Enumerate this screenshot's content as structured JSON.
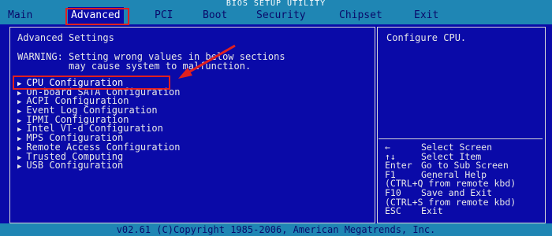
{
  "title": "BIOS SETUP UTILITY",
  "menu": [
    {
      "label": "Main"
    },
    {
      "label": "Advanced"
    },
    {
      "label": "PCI"
    },
    {
      "label": "Boot"
    },
    {
      "label": "Security"
    },
    {
      "label": "Chipset"
    },
    {
      "label": "Exit"
    }
  ],
  "left": {
    "heading": "Advanced Settings",
    "warning_line1": "WARNING: Setting wrong values in below sections",
    "warning_line2": "         may cause system to malfunction.",
    "items": [
      {
        "label": "CPU Configuration"
      },
      {
        "label": "On-board SATA Configuration"
      },
      {
        "label": "ACPI Configuration"
      },
      {
        "label": "Event Log Configuration"
      },
      {
        "label": "IPMI Configuration"
      },
      {
        "label": "Intel VT-d Configuration"
      },
      {
        "label": "MPS Configuration"
      },
      {
        "label": "Remote Access Configuration"
      },
      {
        "label": "Trusted Computing"
      },
      {
        "label": "USB Configuration"
      }
    ]
  },
  "right": {
    "description": "Configure CPU.",
    "help": [
      {
        "key": "←",
        "action": "Select Screen"
      },
      {
        "key": "↑↓",
        "action": "Select Item"
      },
      {
        "key": "Enter",
        "action": "Go to Sub Screen"
      },
      {
        "key": "F1",
        "action": "General Help"
      },
      {
        "key": "(CTRL+Q",
        "action": "from remote kbd)"
      },
      {
        "key": "F10",
        "action": "Save and Exit"
      },
      {
        "key": "(CTRL+S",
        "action": "from remote kbd)"
      },
      {
        "key": "ESC",
        "action": "Exit"
      }
    ]
  },
  "footer": "v02.61 (C)Copyright 1985-2006, American Megatrends, Inc.",
  "colors": {
    "background": "#0a0aa8",
    "bar": "#1f86b4",
    "annotation": "#e02020"
  }
}
